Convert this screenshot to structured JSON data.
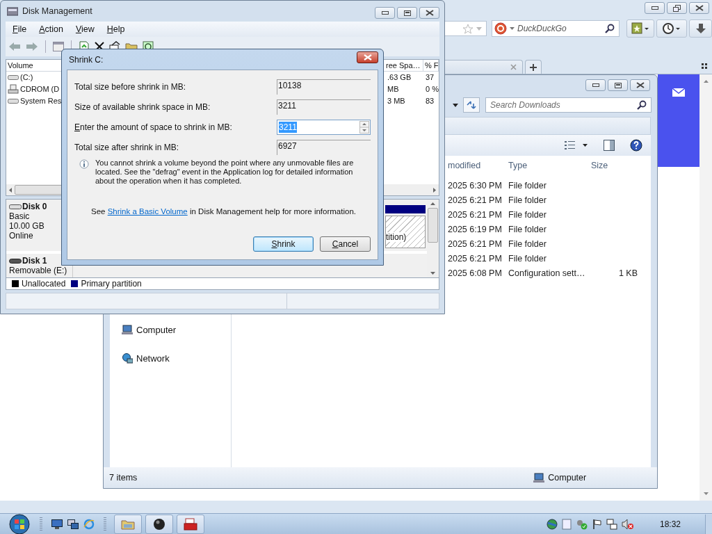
{
  "browser": {
    "search": {
      "placeholder": "DuckDuckGo"
    }
  },
  "explorer": {
    "search": {
      "placeholder": "Search Downloads"
    },
    "columns": [
      "modified",
      "Type",
      "Size"
    ],
    "rows": [
      {
        "modified": "2025 6:30 PM",
        "type": "File folder"
      },
      {
        "modified": "2025 6:21 PM",
        "type": "File folder"
      },
      {
        "modified": "2025 6:21 PM",
        "type": "File folder"
      },
      {
        "modified": "2025 6:19 PM",
        "type": "File folder"
      },
      {
        "modified": "2025 6:21 PM",
        "type": "File folder"
      },
      {
        "modified": "2025 6:21 PM",
        "type": "File folder"
      },
      {
        "modified": "2025 6:08 PM",
        "type": "Configuration sett…",
        "size": "1 KB"
      }
    ],
    "nav": [
      {
        "label": "Computer",
        "kind": "computer"
      },
      {
        "label": "Network",
        "kind": "network"
      }
    ],
    "status": {
      "count": "7 items",
      "location": "Computer"
    }
  },
  "disk_management": {
    "title": "Disk Management",
    "menu": [
      "File",
      "Action",
      "View",
      "Help"
    ],
    "volumes": {
      "columns": [
        "Volume",
        "ree Spa…",
        "% F"
      ],
      "rows": [
        {
          "kind": "disk",
          "cells": [
            "(C:)",
            ".63 GB",
            "37"
          ]
        },
        {
          "kind": "cdrom",
          "cells": [
            "CDROM (D",
            "MB",
            "0 %"
          ]
        },
        {
          "kind": "disk",
          "cells": [
            "System Res",
            "3 MB",
            "83"
          ]
        }
      ]
    },
    "disks": [
      {
        "name": "Disk 0",
        "kind": "fixed",
        "details": [
          "Basic",
          "10.00 GB",
          "Online"
        ],
        "partition": "tition)"
      },
      {
        "name": "Disk 1",
        "kind": "removable",
        "details": [
          "Removable (E:)"
        ]
      }
    ],
    "legend": [
      {
        "label": "Unallocated",
        "color": "#000000"
      },
      {
        "label": "Primary partition",
        "color": "#000080"
      }
    ]
  },
  "dialog": {
    "title": "Shrink C:",
    "fields": [
      {
        "kind": "readonly",
        "label": "Total size before shrink in MB:",
        "value": "10138"
      },
      {
        "kind": "readonly",
        "label": "Size of available shrink space in MB:",
        "value": "3211"
      },
      {
        "kind": "spin",
        "label": "Enter the amount of space to shrink in MB:",
        "value": "3211",
        "text_selected": true
      },
      {
        "kind": "readonly",
        "label": "Total size after shrink in MB:",
        "value": "6927"
      }
    ],
    "note": "You cannot shrink a volume beyond the point where any unmovable files are located. See the \"defrag\" event in the Application log for detailed information about the operation when it has completed.",
    "help": {
      "before": "See",
      "link": "Shrink a Basic Volume",
      "after": "in Disk Management help for more information."
    },
    "buttons": [
      {
        "label": "Shrink",
        "default": true
      },
      {
        "label": "Cancel",
        "default": false
      }
    ]
  },
  "taskbar": {
    "buttons": [
      {
        "kind": "explorer"
      },
      {
        "kind": "orb"
      },
      {
        "kind": "disk"
      }
    ],
    "clock": "18:32"
  }
}
